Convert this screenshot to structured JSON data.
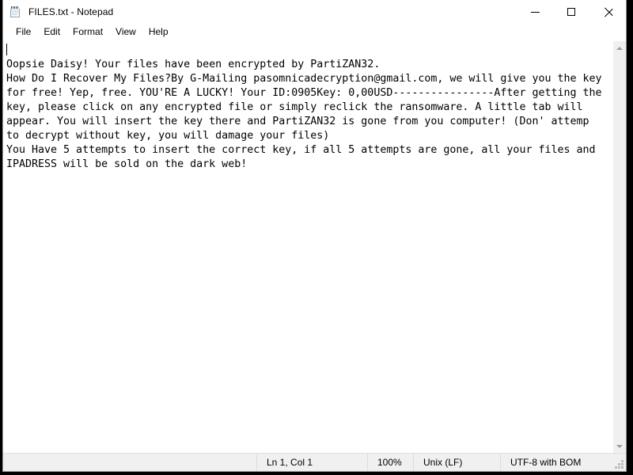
{
  "window": {
    "title": "FILES.txt - Notepad",
    "icon": "notepad-icon",
    "controls": {
      "minimize": "Minimize",
      "maximize": "Maximize",
      "close": "Close"
    }
  },
  "menu": {
    "items": [
      {
        "label": "File"
      },
      {
        "label": "Edit"
      },
      {
        "label": "Format"
      },
      {
        "label": "View"
      },
      {
        "label": "Help"
      }
    ]
  },
  "editor": {
    "content": "\nOopsie Daisy! Your files have been encrypted by PartiZAN32.\nHow Do I Recover My Files?By G-Mailing pasomnicadecryption@gmail.com, we will give you the key for free! Yep, free. YOU'RE A LUCKY! Your ID:0905Key: 0,00USD----------------After getting the key, please click on any encrypted file or simply reclick the ransomware. A little tab will appear. You will insert the key there and PartiZAN32 is gone from you computer! (Don' attemp to decrypt without key, you will damage your files)\nYou Have 5 attempts to insert the correct key, if all 5 attempts are gone, all your files and IPADRESS will be sold on the dark web!",
    "caret_visible": true,
    "scrollbar": {
      "up_arrow": "scroll-up",
      "down_arrow": "scroll-down"
    }
  },
  "status_bar": {
    "position": "Ln 1, Col 1",
    "zoom": "100%",
    "line_ending": "Unix (LF)",
    "encoding": "UTF-8 with BOM"
  },
  "colors": {
    "window_bg": "#ffffff",
    "status_bg": "#f0f0f0",
    "text": "#000000",
    "desktop": "#000000",
    "scrollbar_track": "#f0f0f0",
    "scrollbar_arrow": "#a0a0a0"
  }
}
